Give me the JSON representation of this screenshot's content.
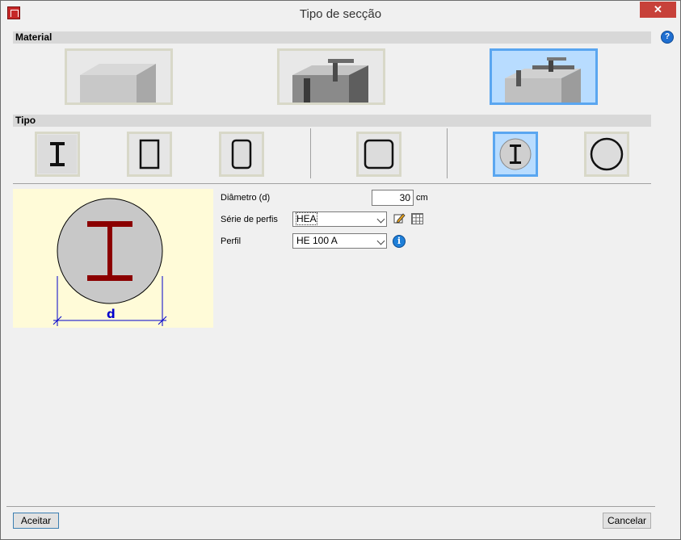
{
  "window": {
    "title": "Tipo de secção",
    "close_label": "✕"
  },
  "help": {
    "label": "?"
  },
  "sections": {
    "material": "Material",
    "tipo": "Tipo"
  },
  "colors": {
    "selected_border": "#5aa6f0",
    "selected_bg": "#b8dcff",
    "preview_bg": "#fffbd8",
    "steel_profile": "#8b0000",
    "dimension_blue": "#0000cc"
  },
  "material_options": [
    {
      "name": "concrete",
      "selected": false
    },
    {
      "name": "steel",
      "selected": false
    },
    {
      "name": "composite",
      "selected": true
    }
  ],
  "tipo_options": [
    {
      "name": "i-profile",
      "selected": false
    },
    {
      "name": "rect-tube",
      "selected": false
    },
    {
      "name": "rounded-rect-tube",
      "selected": false
    },
    {
      "name": "square-tube",
      "selected": false
    },
    {
      "name": "circle-with-i",
      "selected": true
    },
    {
      "name": "circle",
      "selected": false
    }
  ],
  "preview": {
    "dimension_label": "d"
  },
  "form": {
    "diametro_label": "Diâmetro (d)",
    "diametro_value": "30",
    "diametro_unit": "cm",
    "serie_label": "Série de perfis",
    "serie_value": "HEA",
    "perfil_label": "Perfil",
    "perfil_value": "HE 100 A"
  },
  "buttons": {
    "accept": "Aceitar",
    "cancel": "Cancelar"
  }
}
